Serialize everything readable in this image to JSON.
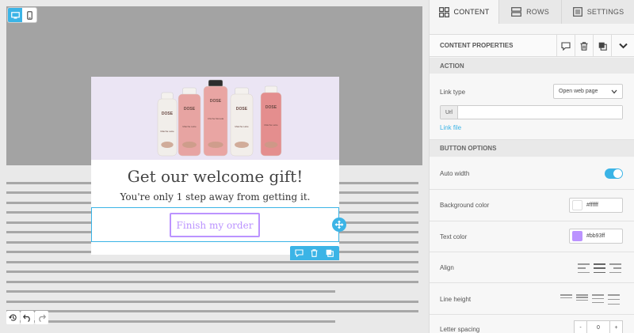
{
  "email": {
    "title": "Get our welcome gift!",
    "subtitle": "You're only 1 step away from getting it.",
    "button_label": "Finish my order",
    "products": [
      {
        "brand": "DOSE",
        "flavor": "Matcha Latte",
        "color": "#f1eeea"
      },
      {
        "brand": "DOSE",
        "flavor": "Matcha Latte",
        "color": "#e7a4a2"
      },
      {
        "brand": "DOSE",
        "flavor": "Chicha Morada",
        "color": "#e9a5a3"
      },
      {
        "brand": "DOSE",
        "flavor": "Matcha Latte",
        "color": "#f2eeea"
      },
      {
        "brand": "DOSE",
        "flavor": "Matcha Latte",
        "color": "#e48e8e"
      }
    ]
  },
  "tabs": [
    {
      "label": "CONTENT",
      "icon": "grid-icon",
      "active": true
    },
    {
      "label": "ROWS",
      "icon": "rows-icon",
      "active": false
    },
    {
      "label": "SETTINGS",
      "icon": "settings-icon",
      "active": false
    }
  ],
  "panel": {
    "header_title": "CONTENT PROPERTIES",
    "action_section": "ACTION",
    "link_type_label": "Link type",
    "link_type_value": "Open web page",
    "url_prefix": "Url",
    "url_value": "",
    "link_file": "Link file",
    "button_options_section": "BUTTON OPTIONS",
    "auto_width_label": "Auto width",
    "auto_width_on": true,
    "bg_color_label": "Background color",
    "bg_color_value": "#ffffff",
    "text_color_label": "Text color",
    "text_color_value": "#bb93ff",
    "align_label": "Align",
    "line_height_label": "Line height",
    "letter_spacing_label": "Letter spacing",
    "letter_spacing_minus": "-",
    "letter_spacing_value": "0",
    "letter_spacing_plus": "+"
  },
  "colors": {
    "accent": "#3bb4e6",
    "button_text": "#bb93ff",
    "hero_bg": "#ebe5f4"
  }
}
